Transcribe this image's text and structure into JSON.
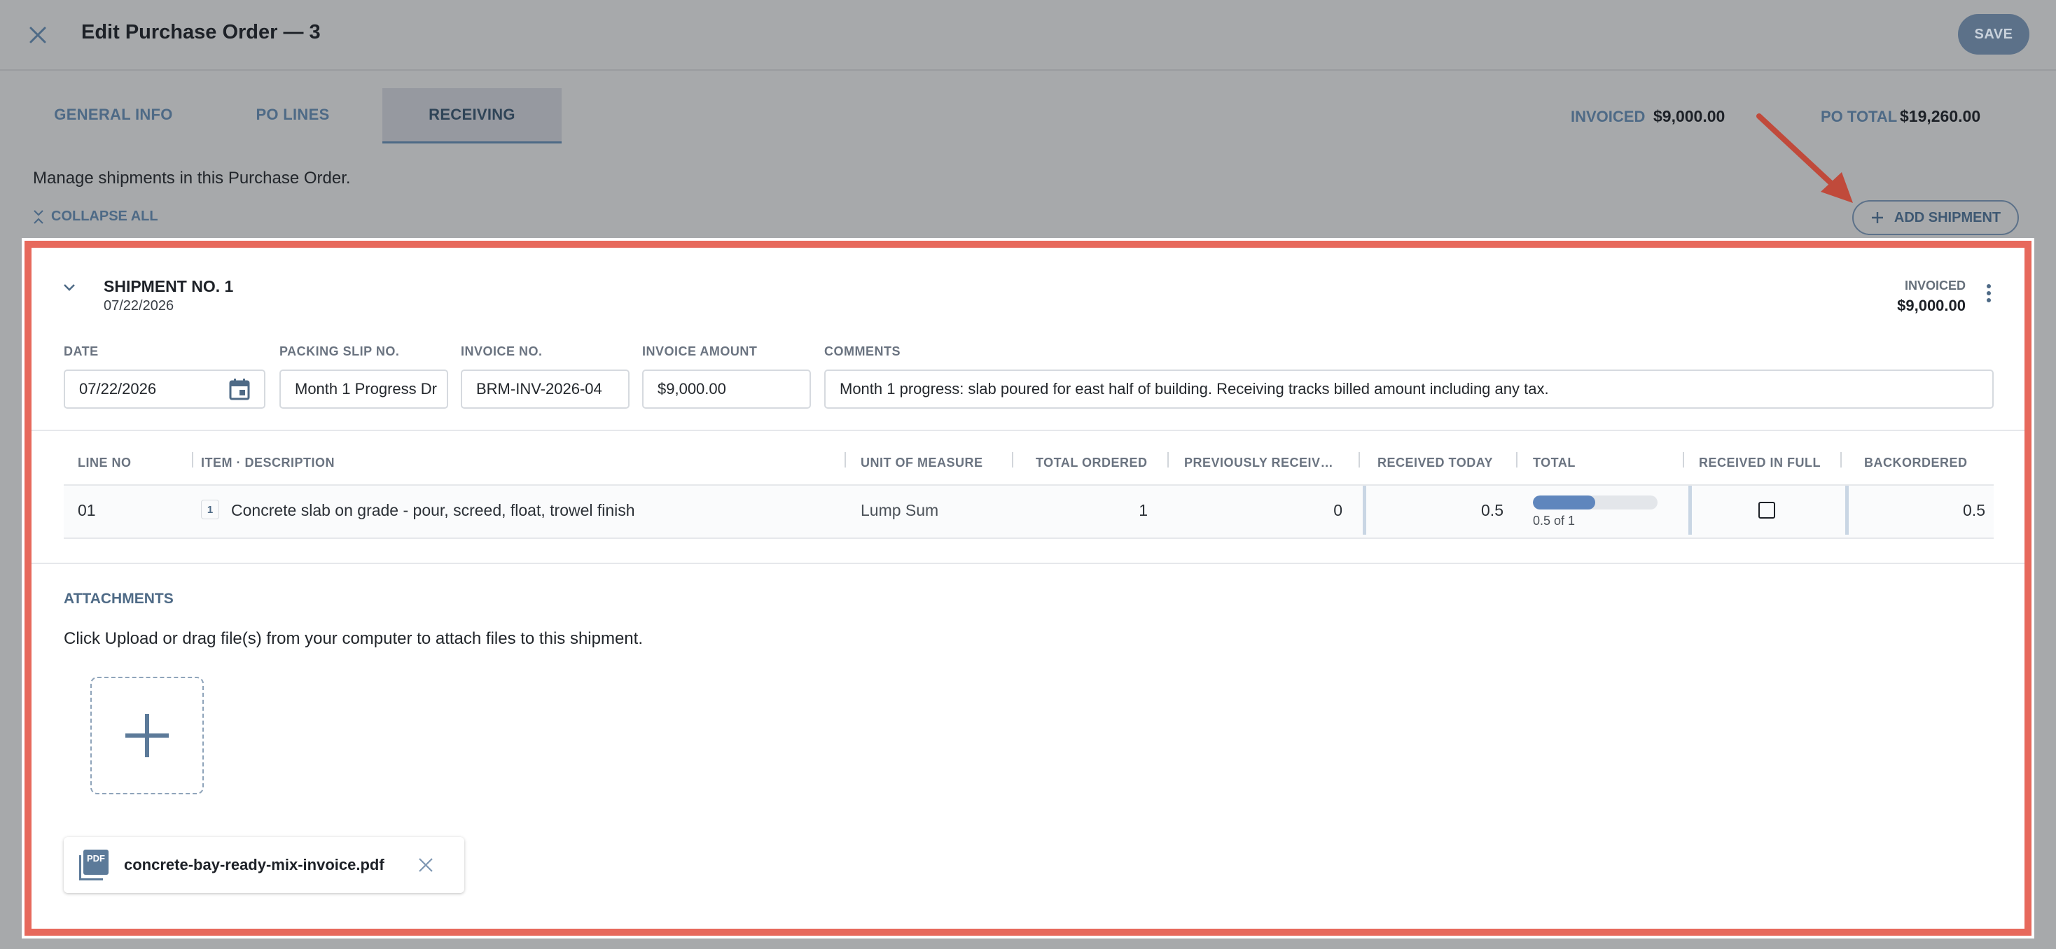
{
  "header": {
    "title": "Edit Purchase Order — 3",
    "save_label": "SAVE"
  },
  "tabs": [
    {
      "label": "GENERAL INFO"
    },
    {
      "label": "PO LINES"
    },
    {
      "label": "RECEIVING",
      "active": true
    }
  ],
  "summary": {
    "invoiced_label": "INVOICED",
    "invoiced_value": "$9,000.00",
    "po_total_label": "PO TOTAL",
    "po_total_value": "$19,260.00"
  },
  "description": "Manage shipments in this Purchase Order.",
  "collapse_all_label": "COLLAPSE ALL",
  "add_shipment_label": "ADD SHIPMENT",
  "shipment": {
    "title": "SHIPMENT NO. 1",
    "date": "07/22/2026",
    "invoiced_label": "INVOICED",
    "invoiced_value": "$9,000.00",
    "fields": {
      "date_label": "DATE",
      "date_value": "07/22/2026",
      "packing_slip_label": "PACKING SLIP NO.",
      "packing_slip_value": "Month 1 Progress Dr",
      "invoice_no_label": "INVOICE NO.",
      "invoice_no_value": "BRM-INV-2026-04",
      "invoice_amount_label": "INVOICE AMOUNT",
      "invoice_amount_value": "$9,000.00",
      "comments_label": "COMMENTS",
      "comments_value": "Month 1 progress: slab poured for east half of building. Receiving tracks billed amount including any tax."
    },
    "table": {
      "headers": [
        "LINE NO",
        "ITEM · DESCRIPTION",
        "UNIT OF MEASURE",
        "TOTAL ORDERED",
        "PREVIOUSLY RECEIV…",
        "RECEIVED TODAY",
        "TOTAL",
        "RECEIVED IN FULL",
        "BACKORDERED"
      ],
      "rows": [
        {
          "line_no": "01",
          "item_badge": "1",
          "description": "Concrete slab on grade - pour, screed, float, trowel finish",
          "unit": "Lump Sum",
          "total_ordered": "1",
          "previously_received": "0",
          "received_today": "0.5",
          "total_progress": 0.5,
          "total_text": "0.5 of 1",
          "received_in_full": false,
          "backordered": "0.5"
        }
      ]
    },
    "attachments": {
      "title": "ATTACHMENTS",
      "description": "Click Upload or drag file(s) from your computer to attach files to this shipment.",
      "files": [
        {
          "name": "concrete-bay-ready-mix-invoice.pdf",
          "icon_text": "PDF"
        }
      ]
    }
  },
  "colors": {
    "accent": "#4e6a86",
    "highlight": "#e7695c",
    "save_bg": "#5c7189"
  }
}
